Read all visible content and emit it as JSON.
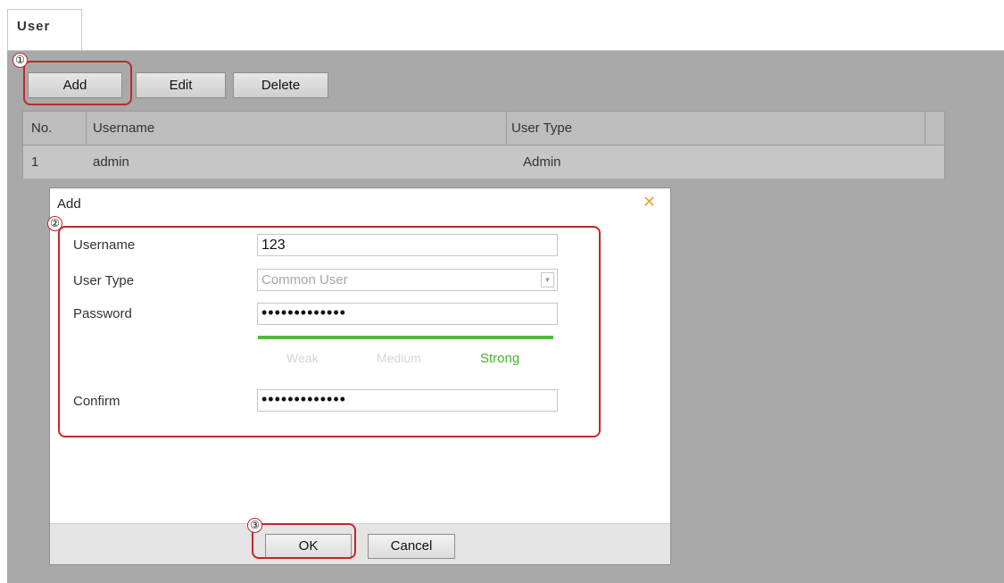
{
  "tabs": [
    {
      "label": "User"
    }
  ],
  "toolbar": {
    "add_label": "Add",
    "edit_label": "Edit",
    "delete_label": "Delete"
  },
  "table": {
    "columns": [
      "No.",
      "Username",
      "User Type"
    ],
    "rows": [
      {
        "no": "1",
        "username": "admin",
        "user_type": "Admin"
      }
    ]
  },
  "dialog": {
    "title": "Add",
    "close_icon": "close-icon",
    "fields": {
      "username": {
        "label": "Username",
        "value": "123"
      },
      "user_type": {
        "label": "User Type",
        "value": "Common User"
      },
      "password": {
        "label": "Password",
        "value": "•••••••••••••"
      },
      "confirm": {
        "label": "Confirm",
        "value": "•••••••••••••"
      }
    },
    "strength": {
      "weak": "Weak",
      "medium": "Medium",
      "strong": "Strong",
      "level": "Strong"
    },
    "ok_label": "OK",
    "cancel_label": "Cancel"
  },
  "markers": {
    "one": "①",
    "two": "②",
    "three": "③"
  },
  "colors": {
    "callout": "#c1272d",
    "strength_strong": "#4ebd37",
    "close_icon": "#e8a33a"
  }
}
